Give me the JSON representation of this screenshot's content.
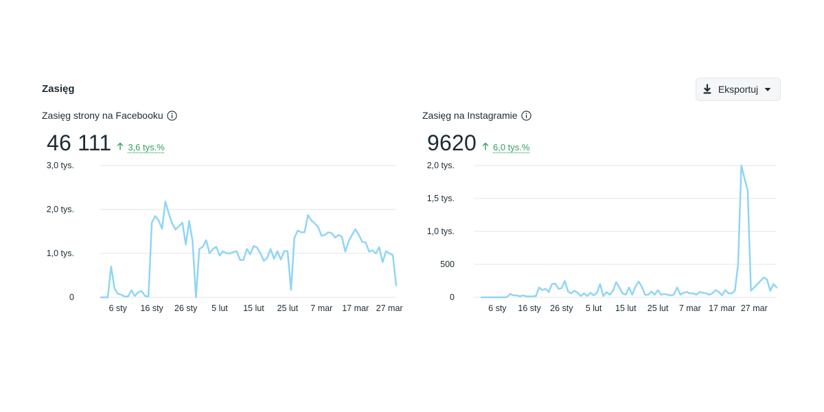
{
  "section": {
    "title": "Zasięg"
  },
  "export_button": {
    "label": "Eksportuj",
    "icon": "download-icon",
    "caret_icon": "caret-down-icon"
  },
  "colors": {
    "line": "#8fd5f7",
    "positive": "#2e9e5e",
    "grid": "#e4e6eb"
  },
  "panels": [
    {
      "title": "Zasięg strony na Facebooku",
      "value": "46 111",
      "delta": "3,6 tys.%",
      "delta_icon": "arrow-up-icon"
    },
    {
      "title": "Zasięg na Instagramie",
      "value": "9620",
      "delta": "6,0 tys.%",
      "delta_icon": "arrow-up-icon"
    }
  ],
  "chart_data": [
    {
      "type": "line",
      "title": "Zasięg strony na Facebooku",
      "ylim": [
        0,
        3000
      ],
      "y_ticks": [
        0,
        1000,
        2000,
        3000
      ],
      "y_tick_labels": [
        "0",
        "1,0 tys.",
        "2,0 tys.",
        "3,0 tys."
      ],
      "x_tick_labels": [
        "6 sty",
        "16 sty",
        "26 sty",
        "5 lut",
        "15 lut",
        "25 lut",
        "7 mar",
        "17 mar",
        "27 mar"
      ],
      "x_tick_index": [
        5,
        15,
        25,
        35,
        45,
        55,
        65,
        75,
        85
      ],
      "grid": true,
      "legend": "none",
      "series": [
        {
          "values": [
            0,
            0,
            0,
            700,
            200,
            80,
            60,
            20,
            20,
            160,
            30,
            120,
            140,
            30,
            20,
            1700,
            1850,
            1750,
            1560,
            2180,
            1900,
            1680,
            1540,
            1620,
            1700,
            1200,
            1740,
            1280,
            0,
            1100,
            1150,
            1300,
            1000,
            1100,
            1150,
            950,
            1050,
            1000,
            1000,
            1030,
            1050,
            850,
            850,
            1100,
            980,
            1170,
            1130,
            1000,
            830,
            900,
            1100,
            880,
            1050,
            860,
            1050,
            1050,
            170,
            1350,
            1520,
            1480,
            1480,
            1870,
            1750,
            1680,
            1600,
            1400,
            1420,
            1480,
            1460,
            1360,
            1420,
            1380,
            1040,
            1280,
            1420,
            1550,
            1420,
            1260,
            1250,
            1040,
            1070,
            1000,
            1140,
            800,
            1050,
            1000,
            960,
            270
          ]
        }
      ]
    },
    {
      "type": "line",
      "title": "Zasięg na Instagramie",
      "ylim": [
        0,
        2000
      ],
      "y_ticks": [
        0,
        500,
        1000,
        1500,
        2000
      ],
      "y_tick_labels": [
        "0",
        "500",
        "1,0 tys.",
        "1,5 tys.",
        "2,0 tys."
      ],
      "x_tick_labels": [
        "6 sty",
        "16 sty",
        "26 sty",
        "5 lut",
        "15 lut",
        "25 lut",
        "7 mar",
        "17 mar",
        "27 mar"
      ],
      "x_tick_index": [
        5,
        15,
        25,
        35,
        45,
        55,
        65,
        75,
        85
      ],
      "grid": true,
      "legend": "none",
      "series": [
        {
          "values": [
            0,
            0,
            0,
            0,
            0,
            0,
            0,
            0,
            5,
            50,
            30,
            30,
            15,
            30,
            15,
            15,
            15,
            20,
            150,
            110,
            130,
            80,
            200,
            210,
            130,
            140,
            250,
            90,
            60,
            100,
            70,
            20,
            60,
            20,
            70,
            30,
            70,
            200,
            20,
            80,
            40,
            100,
            230,
            150,
            60,
            40,
            150,
            40,
            160,
            240,
            160,
            40,
            40,
            90,
            40,
            110,
            40,
            50,
            40,
            30,
            40,
            150,
            40,
            70,
            80,
            60,
            60,
            40,
            80,
            70,
            60,
            40,
            60,
            110,
            80,
            30,
            110,
            60,
            60,
            100,
            500,
            2000,
            1800,
            1620,
            100,
            150,
            200,
            250,
            300,
            270,
            100,
            200,
            150
          ]
        }
      ]
    }
  ]
}
